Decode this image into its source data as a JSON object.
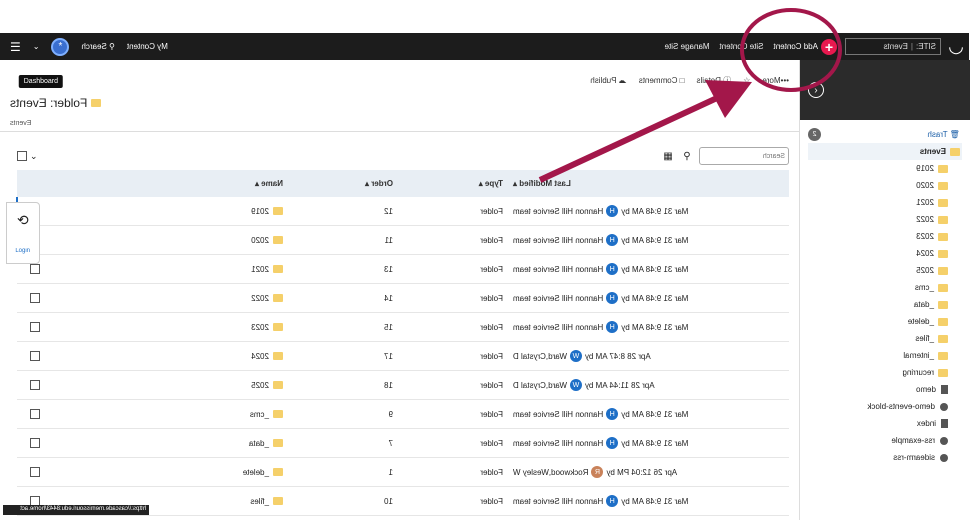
{
  "topbar": {
    "site_label": "SITE:",
    "site_value": "Events",
    "add_content": "Add Content",
    "site_content": "Site Content",
    "manage_site": "Manage Site",
    "my_content": "My Content",
    "search": "Search",
    "avatar_initial": "*"
  },
  "tooltip": "Dashboard",
  "sidebar": {
    "trash": "Trash",
    "trash_count": "2",
    "root": "Events",
    "items": [
      {
        "label": "2019",
        "kind": "folder"
      },
      {
        "label": "2020",
        "kind": "folder"
      },
      {
        "label": "2021",
        "kind": "folder"
      },
      {
        "label": "2022",
        "kind": "folder"
      },
      {
        "label": "2023",
        "kind": "folder"
      },
      {
        "label": "2024",
        "kind": "folder"
      },
      {
        "label": "2025",
        "kind": "folder"
      },
      {
        "label": "_cms",
        "kind": "folder"
      },
      {
        "label": "_data",
        "kind": "folder"
      },
      {
        "label": "_delete",
        "kind": "folder"
      },
      {
        "label": "_files",
        "kind": "folder"
      },
      {
        "label": "_internal",
        "kind": "folder"
      },
      {
        "label": "recurring",
        "kind": "folder"
      },
      {
        "label": "demo",
        "kind": "file"
      },
      {
        "label": "demo-events-block",
        "kind": "block"
      },
      {
        "label": "index",
        "kind": "file"
      },
      {
        "label": "rss-example",
        "kind": "block"
      },
      {
        "label": "sidearm-rss",
        "kind": "block"
      }
    ]
  },
  "actions": {
    "publish": "Publish",
    "comments": "Comments",
    "details": "Details",
    "more": "More"
  },
  "folder_title": "Folder: Events",
  "breadcrumb": "Events",
  "search_placeholder": "Search",
  "table": {
    "headers": {
      "name": "Name",
      "order": "Order",
      "type": "Type",
      "modified": "Last Modified"
    },
    "rows": [
      {
        "name": "2019",
        "order": "12",
        "type": "Folder",
        "modified": "Mar 31 9:48 AM by",
        "user": "Hannon Hill Service team",
        "initial": "H"
      },
      {
        "name": "2020",
        "order": "11",
        "type": "Folder",
        "modified": "Mar 31 9:48 AM by",
        "user": "Hannon Hill Service team",
        "initial": "H"
      },
      {
        "name": "2021",
        "order": "13",
        "type": "Folder",
        "modified": "Mar 31 9:48 AM by",
        "user": "Hannon Hill Service team",
        "initial": "H"
      },
      {
        "name": "2022",
        "order": "14",
        "type": "Folder",
        "modified": "Mar 31 9:48 AM by",
        "user": "Hannon Hill Service team",
        "initial": "H"
      },
      {
        "name": "2023",
        "order": "15",
        "type": "Folder",
        "modified": "Mar 31 9:48 AM by",
        "user": "Hannon Hill Service team",
        "initial": "H"
      },
      {
        "name": "2024",
        "order": "17",
        "type": "Folder",
        "modified": "Apr 28 8:47 AM by",
        "user": "Ward,Crystal D",
        "initial": "W"
      },
      {
        "name": "2025",
        "order": "18",
        "type": "Folder",
        "modified": "Apr 28 11:44 AM by",
        "user": "Ward,Crystal D",
        "initial": "W"
      },
      {
        "name": "_cms",
        "order": "9",
        "type": "Folder",
        "modified": "Mar 31 9:48 AM by",
        "user": "Hannon Hill Service team",
        "initial": "H"
      },
      {
        "name": "_data",
        "order": "7",
        "type": "Folder",
        "modified": "Mar 31 9:48 AM by",
        "user": "Hannon Hill Service team",
        "initial": "H"
      },
      {
        "name": "_delete",
        "order": "1",
        "type": "Folder",
        "modified": "Apr 26 12:04 PM by",
        "user": "Rockwood,Wesley W",
        "initial": "R"
      },
      {
        "name": "_files",
        "order": "10",
        "type": "Folder",
        "modified": "Mar 31 9:48 AM by",
        "user": "Hannon Hill Service team",
        "initial": "H"
      }
    ]
  },
  "widget": {
    "login": "Login"
  },
  "url": "https://cascade.memissouri.edu:8443/home.act",
  "colors": {
    "accent": "#e8194f",
    "annotation": "#a3174a",
    "topbar": "#1c1c1c",
    "avatar": "#1e6fc7"
  }
}
